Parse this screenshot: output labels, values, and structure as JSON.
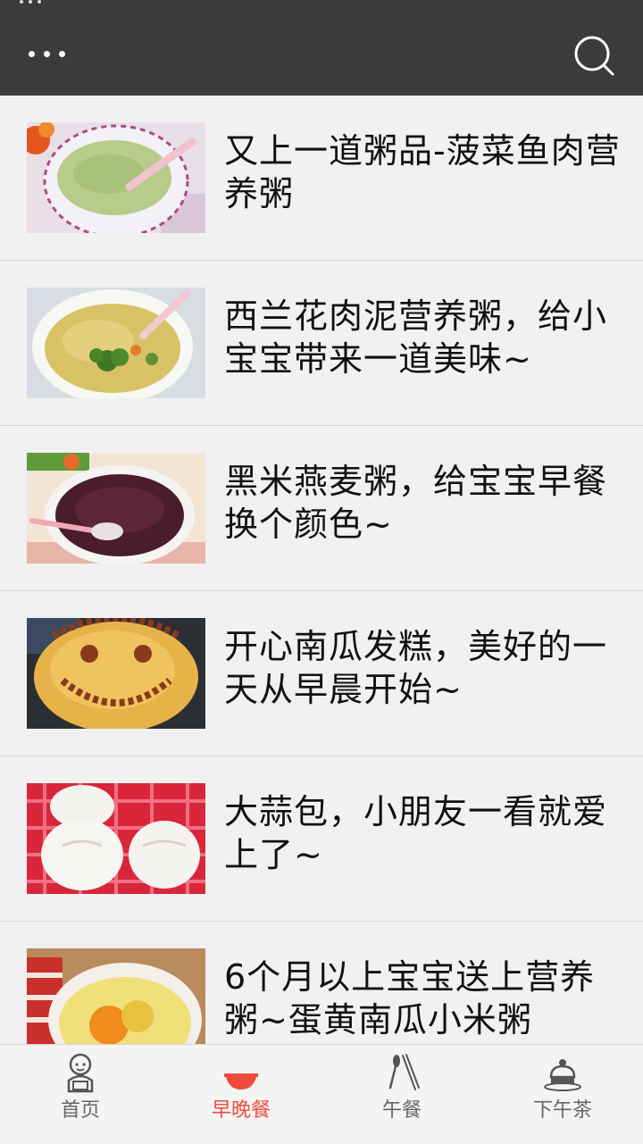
{
  "app": {
    "accent_color": "#ef4b3d",
    "topbar_color": "#3b3b3b"
  },
  "header": {
    "menu_icon": "more-horizontal-icon",
    "search_icon": "search-icon"
  },
  "recipes": [
    {
      "title": "又上一道粥品-菠菜鱼肉营养粥",
      "image": "spinach-fish-porridge-photo"
    },
    {
      "title": "西兰花肉泥营养粥，给小宝宝带来一道美味~",
      "image": "broccoli-meat-porridge-photo"
    },
    {
      "title": "黑米燕麦粥，给宝宝早餐换个颜色~",
      "image": "black-rice-oat-porridge-photo"
    },
    {
      "title": "开心南瓜发糕，美好的一天从早晨开始~",
      "image": "pumpkin-cake-photo"
    },
    {
      "title": "大蒜包，小朋友一看就爱上了~",
      "image": "garlic-bun-photo"
    },
    {
      "title": "6个月以上宝宝送上营养粥~蛋黄南瓜小米粥",
      "image": "millet-porridge-photo"
    }
  ],
  "tabs": [
    {
      "label": "首页",
      "icon": "baby-icon",
      "active": false
    },
    {
      "label": "早晚餐",
      "icon": "bowl-icon",
      "active": true
    },
    {
      "label": "午餐",
      "icon": "spoon-chopsticks-icon",
      "active": false
    },
    {
      "label": "下午茶",
      "icon": "cake-icon",
      "active": false
    }
  ]
}
